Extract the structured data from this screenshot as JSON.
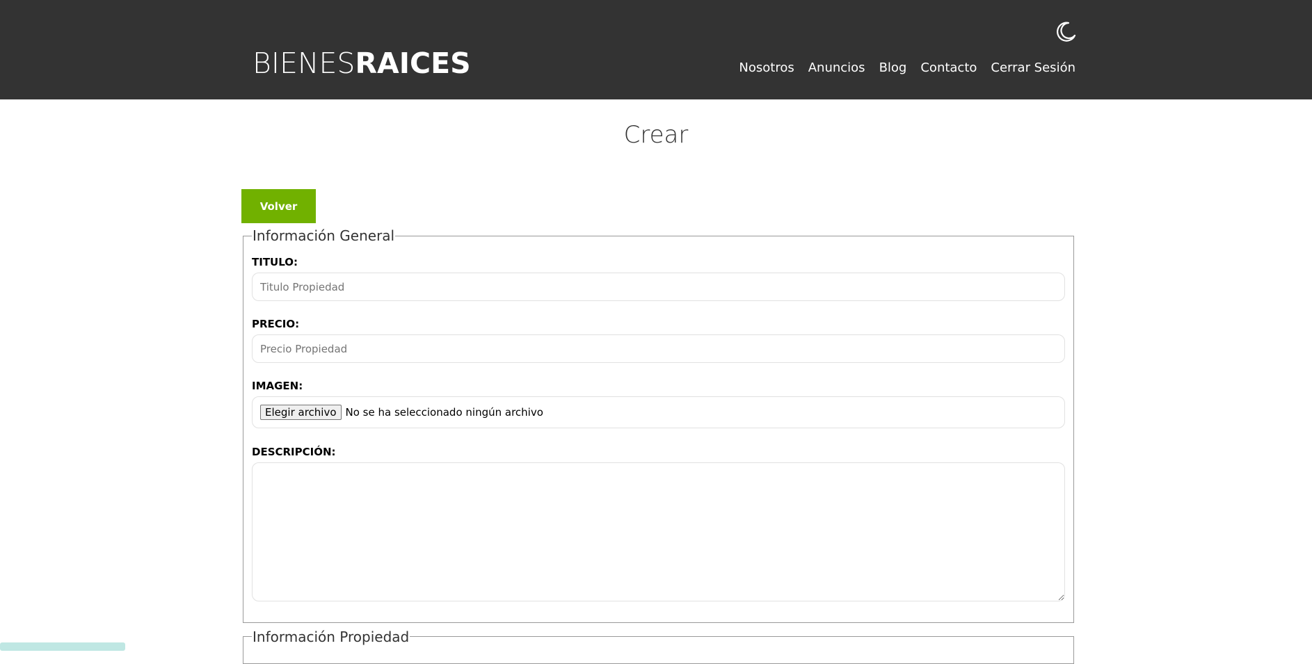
{
  "header": {
    "logo_light": "BIENES",
    "logo_bold": "RAICES",
    "theme_toggle_icon": "moon-icon",
    "nav": [
      {
        "label": "Nosotros"
      },
      {
        "label": "Anuncios"
      },
      {
        "label": "Blog"
      },
      {
        "label": "Contacto"
      },
      {
        "label": "Cerrar Sesión"
      }
    ],
    "background": "#333333"
  },
  "main": {
    "title": "Crear",
    "back_button": "Volver",
    "accent_color": "#71b100",
    "general_info": {
      "legend": "Información General",
      "titulo_label": "TITULO:",
      "titulo_placeholder": "Titulo Propiedad",
      "titulo_value": "",
      "precio_label": "PRECIO:",
      "precio_placeholder": "Precio Propiedad",
      "precio_value": "",
      "imagen_label": "IMAGEN:",
      "file_button": "Elegir archivo",
      "file_status": "No se ha seleccionado ningún archivo",
      "descripcion_label": "DESCRIPCIÓN:",
      "descripcion_value": ""
    },
    "property_info": {
      "legend": "Información Propiedad"
    }
  }
}
